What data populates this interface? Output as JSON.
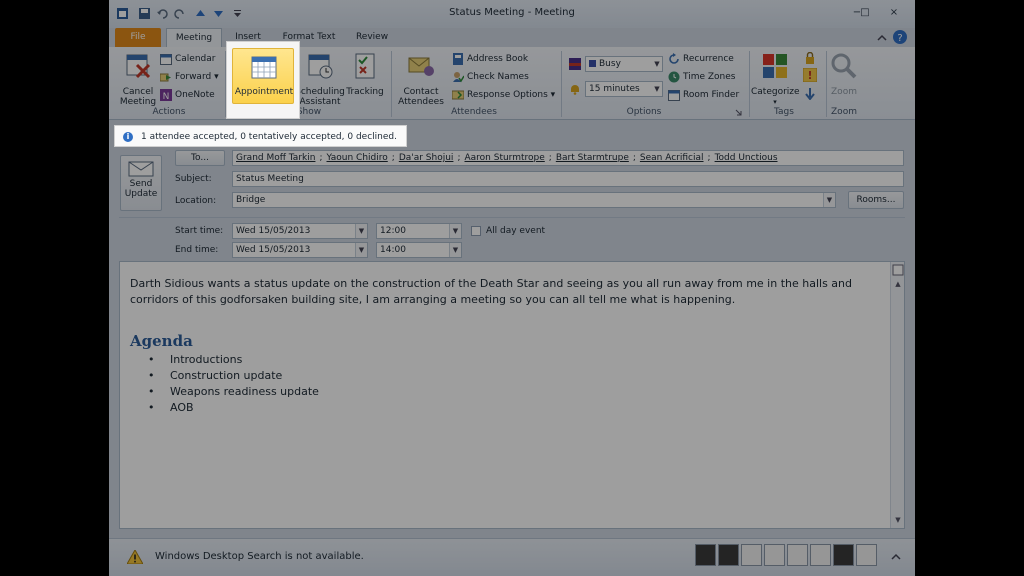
{
  "window": {
    "title": "Status Meeting  -  Meeting",
    "controls": {
      "minimize": "−",
      "maximize": "□",
      "close": "×"
    }
  },
  "tabs": [
    "File",
    "Meeting",
    "Insert",
    "Format Text",
    "Review"
  ],
  "ribbon": {
    "actions": {
      "label": "Actions",
      "cancel_meeting": "Cancel\nMeeting",
      "calendar": "Calendar",
      "forward": "Forward",
      "onenote": "OneNote"
    },
    "show": {
      "label": "Show",
      "appointment": "Appointment",
      "scheduling_assistant": "Scheduling\nAssistant",
      "tracking": "Tracking"
    },
    "attendees": {
      "label": "Attendees",
      "contact_attendees": "Contact\nAttendees",
      "address_book": "Address Book",
      "check_names": "Check Names",
      "response_options": "Response Options"
    },
    "options": {
      "label": "Options",
      "show_as": "Busy",
      "reminder": "15 minutes",
      "recurrence": "Recurrence",
      "time_zones": "Time Zones",
      "room_finder": "Room Finder"
    },
    "tags": {
      "label": "Tags",
      "categorize": "Categorize"
    },
    "zoom": {
      "label": "Zoom",
      "zoom": "Zoom"
    }
  },
  "infobar": {
    "text": "1 attendee accepted, 0 tentatively accepted, 0 declined."
  },
  "form": {
    "send_update": "Send\nUpdate",
    "to_button": "To...",
    "attendees": [
      "Grand Moff Tarkin",
      "Yaoun Chidiro",
      "Da'ar Shojui",
      "Aaron Sturmtrope",
      "Bart Starmtrupe",
      "Sean Acrificial",
      "Todd Unctious"
    ],
    "subject_label": "Subject:",
    "subject": "Status Meeting",
    "location_label": "Location:",
    "location": "Bridge",
    "rooms_button": "Rooms...",
    "start_label": "Start time:",
    "start_date": "Wed 15/05/2013",
    "start_time": "12:00",
    "end_label": "End time:",
    "end_date": "Wed 15/05/2013",
    "end_time": "14:00",
    "all_day": "All day event"
  },
  "body": {
    "paragraph": "Darth Sidious wants a status update on the construction of the Death Star and seeing as you all run away from me in the halls and corridors of this godforsaken building site, I am arranging a meeting so you can all tell me what is happening.",
    "agenda_heading": "Agenda",
    "agenda_items": [
      "Introductions",
      "Construction update",
      "Weapons readiness update",
      "AOB"
    ]
  },
  "status": {
    "text": "Windows Desktop Search is not available."
  },
  "colors": {
    "file_tab": "#e08a1a",
    "appointment_highlight": "#fbd14b",
    "agenda_heading": "#2d5d9a"
  }
}
